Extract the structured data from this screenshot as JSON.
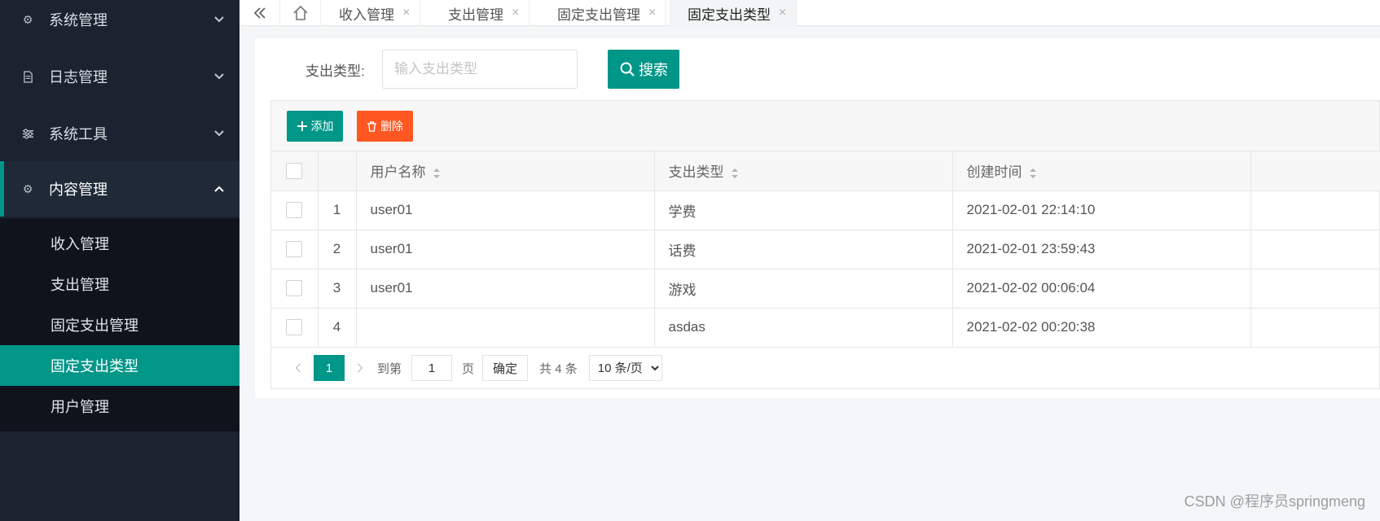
{
  "sidebar": {
    "menus": [
      {
        "label": "系统管理",
        "icon": "gear-icon"
      },
      {
        "label": "日志管理",
        "icon": "document-icon"
      },
      {
        "label": "系统工具",
        "icon": "sliders-icon"
      },
      {
        "label": "内容管理",
        "icon": "gear-icon"
      }
    ],
    "submenu": [
      "收入管理",
      "支出管理",
      "固定支出管理",
      "固定支出类型",
      "用户管理"
    ],
    "selected_submenu": "固定支出类型"
  },
  "tabs": {
    "items": [
      {
        "label": "收入管理"
      },
      {
        "label": "支出管理"
      },
      {
        "label": "固定支出管理"
      },
      {
        "label": "固定支出类型"
      }
    ],
    "current": "固定支出类型",
    "close_glyph": "×"
  },
  "search": {
    "label": "支出类型:",
    "placeholder": "输入支出类型",
    "value": "",
    "button_label": "搜索"
  },
  "toolbar": {
    "add_label": "添加",
    "delete_label": "删除"
  },
  "table": {
    "headers": [
      "用户名称",
      "支出类型",
      "创建时间"
    ],
    "rows": [
      {
        "index": "1",
        "username": "user01",
        "type": "学费",
        "created": "2021-02-01 22:14:10"
      },
      {
        "index": "2",
        "username": "user01",
        "type": "话费",
        "created": "2021-02-01 23:59:43"
      },
      {
        "index": "3",
        "username": "user01",
        "type": "游戏",
        "created": "2021-02-02 00:06:04"
      },
      {
        "index": "4",
        "username": "",
        "type": "asdas",
        "created": "2021-02-02 00:20:38"
      }
    ]
  },
  "pager": {
    "current_page": "1",
    "goto_label": "到第",
    "goto_value": "1",
    "page_unit": "页",
    "confirm_label": "确定",
    "total_label": "共 4 条",
    "page_size_label": "10 条/页"
  },
  "watermark": "CSDN @程序员springmeng",
  "colors": {
    "accent": "#009688",
    "danger": "#ff5722",
    "sidebar_bg": "#1b2331"
  }
}
